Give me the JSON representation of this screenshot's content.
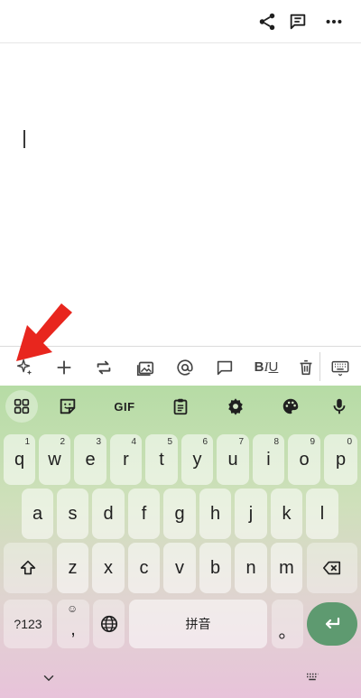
{
  "topbar": {
    "icons": [
      "share-icon",
      "comment-icon",
      "more-vert-icon"
    ]
  },
  "toolbar": {
    "icons": [
      "sparkle-icon",
      "plus-icon",
      "repeat-icon",
      "image-icon",
      "at-icon",
      "comment-icon",
      "text-format-icon",
      "delete-icon",
      "keyboard-icon"
    ],
    "format_bold": "B",
    "format_italic": "I",
    "format_underline": "U"
  },
  "keyboard": {
    "toolbar": {
      "gif_label": "GIF",
      "icons": [
        "apps-grid-icon",
        "sticker-icon",
        "clipboard-icon",
        "settings-gear-icon",
        "palette-icon",
        "microphone-icon"
      ]
    },
    "row1": [
      {
        "label": "q",
        "hint": "1"
      },
      {
        "label": "w",
        "hint": "2"
      },
      {
        "label": "e",
        "hint": "3"
      },
      {
        "label": "r",
        "hint": "4"
      },
      {
        "label": "t",
        "hint": "5"
      },
      {
        "label": "y",
        "hint": "6"
      },
      {
        "label": "u",
        "hint": "7"
      },
      {
        "label": "i",
        "hint": "8"
      },
      {
        "label": "o",
        "hint": "9"
      },
      {
        "label": "p",
        "hint": "0"
      }
    ],
    "row2": [
      "a",
      "s",
      "d",
      "f",
      "g",
      "h",
      "j",
      "k",
      "l"
    ],
    "row3": [
      "z",
      "x",
      "c",
      "v",
      "b",
      "n",
      "m"
    ],
    "symbols_label": "?123",
    "comma_label": ",",
    "comma_hint": "☺",
    "space_label": "拼音",
    "period_label": "。",
    "colors": {
      "accent_enter": "#5e9a70",
      "gradient_top": "#b6dca5",
      "gradient_bottom": "#e8c3da"
    }
  },
  "annotation": {
    "arrow_color": "#e8261e"
  }
}
